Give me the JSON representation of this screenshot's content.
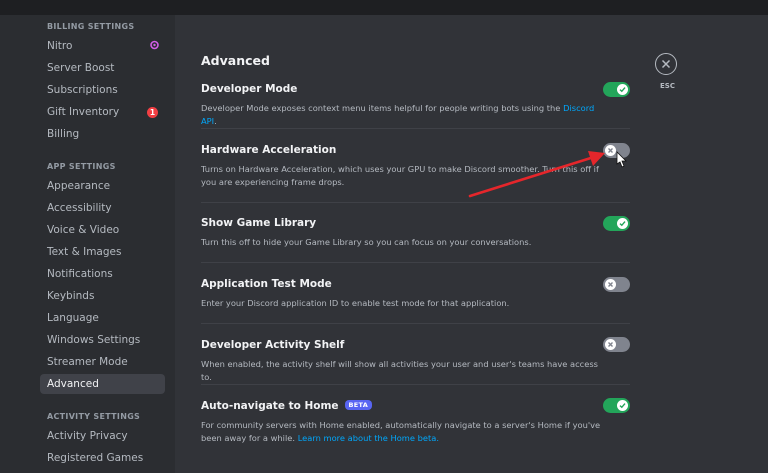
{
  "sidebar": {
    "billing_header": "BILLING SETTINGS",
    "billing_items": [
      {
        "label": "Nitro"
      },
      {
        "label": "Server Boost"
      },
      {
        "label": "Subscriptions"
      },
      {
        "label": "Gift Inventory",
        "badge": "1"
      },
      {
        "label": "Billing"
      }
    ],
    "app_header": "APP SETTINGS",
    "app_items": [
      {
        "label": "Appearance"
      },
      {
        "label": "Accessibility"
      },
      {
        "label": "Voice & Video"
      },
      {
        "label": "Text & Images"
      },
      {
        "label": "Notifications"
      },
      {
        "label": "Keybinds"
      },
      {
        "label": "Language"
      },
      {
        "label": "Windows Settings"
      },
      {
        "label": "Streamer Mode"
      },
      {
        "label": "Advanced",
        "active": true
      }
    ],
    "activity_header": "ACTIVITY SETTINGS",
    "activity_items": [
      {
        "label": "Activity Privacy"
      },
      {
        "label": "Registered Games"
      }
    ]
  },
  "main": {
    "title": "Advanced",
    "close_label": "ESC",
    "settings": [
      {
        "title": "Developer Mode",
        "desc": "Developer Mode exposes context menu items helpful for people writing bots using the ",
        "link": "Discord API",
        "desc_after": ".",
        "enabled": true
      },
      {
        "title": "Hardware Acceleration",
        "desc": "Turns on Hardware Acceleration, which uses your GPU to make Discord smoother. Turn this off if you are experiencing frame drops.",
        "enabled": false
      },
      {
        "title": "Show Game Library",
        "desc": "Turn this off to hide your Game Library so you can focus on your conversations.",
        "enabled": true
      },
      {
        "title": "Application Test Mode",
        "desc": "Enter your Discord application ID to enable test mode for that application.",
        "enabled": false
      },
      {
        "title": "Developer Activity Shelf",
        "desc": "When enabled, the activity shelf will show all activities your user and user's teams have access to.",
        "enabled": false
      },
      {
        "title": "Auto-navigate to Home",
        "badge": "BETA",
        "desc": "For community servers with Home enabled, automatically navigate to a server's Home if you've been away for a while. ",
        "link": "Learn more about the Home beta.",
        "enabled": true
      }
    ]
  },
  "colors": {
    "toggle_on": "#23a55a",
    "toggle_off": "#80848e",
    "annotation_arrow": "#e5262b",
    "link": "#00a8fc",
    "badge_bg": "#5865f2",
    "notification_badge": "#f23f43"
  },
  "annotation": {
    "type": "arrow",
    "points_to": "Hardware Acceleration toggle"
  }
}
